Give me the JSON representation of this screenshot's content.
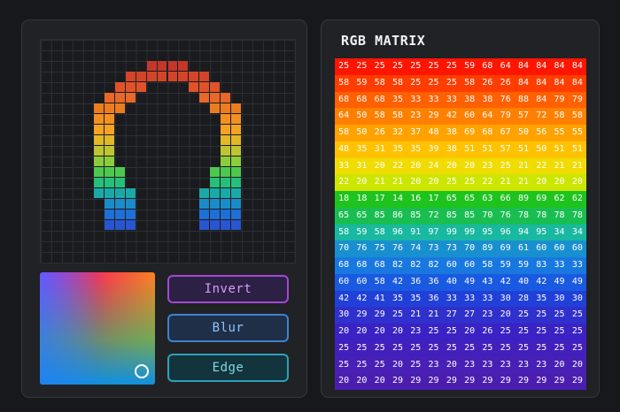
{
  "pixel_art": {
    "grid_cols": 24,
    "grid_rows": 21,
    "rows": [
      {
        "row": 2,
        "ranges": [
          [
            10,
            13
          ]
        ],
        "color": "#c5372a"
      },
      {
        "row": 3,
        "ranges": [
          [
            8,
            15
          ]
        ],
        "color": "#d44428"
      },
      {
        "row": 4,
        "ranges": [
          [
            7,
            9
          ],
          [
            14,
            16
          ]
        ],
        "color": "#e0532a"
      },
      {
        "row": 5,
        "ranges": [
          [
            6,
            8
          ],
          [
            15,
            17
          ]
        ],
        "color": "#e8682a"
      },
      {
        "row": 6,
        "ranges": [
          [
            5,
            7
          ],
          [
            16,
            18
          ]
        ],
        "color": "#ec7c20"
      },
      {
        "row": 7,
        "ranges": [
          [
            5,
            6
          ],
          [
            17,
            18
          ]
        ],
        "color": "#f39022"
      },
      {
        "row": 8,
        "ranges": [
          [
            5,
            6
          ],
          [
            17,
            18
          ]
        ],
        "color": "#f5a323"
      },
      {
        "row": 9,
        "ranges": [
          [
            5,
            6
          ],
          [
            17,
            18
          ]
        ],
        "color": "#e2b827"
      },
      {
        "row": 10,
        "ranges": [
          [
            5,
            6
          ],
          [
            17,
            18
          ]
        ],
        "color": "#bdc532"
      },
      {
        "row": 11,
        "ranges": [
          [
            5,
            6
          ],
          [
            17,
            18
          ]
        ],
        "color": "#8dcc3b"
      },
      {
        "row": 12,
        "ranges": [
          [
            5,
            7
          ],
          [
            16,
            18
          ]
        ],
        "color": "#4ec94f"
      },
      {
        "row": 13,
        "ranges": [
          [
            5,
            7
          ],
          [
            16,
            18
          ]
        ],
        "color": "#25bf7a"
      },
      {
        "row": 14,
        "ranges": [
          [
            5,
            8
          ],
          [
            15,
            18
          ]
        ],
        "color": "#1aa9a6"
      },
      {
        "row": 15,
        "ranges": [
          [
            6,
            8
          ],
          [
            15,
            18
          ]
        ],
        "color": "#1a8cc9"
      },
      {
        "row": 16,
        "ranges": [
          [
            6,
            8
          ],
          [
            15,
            18
          ]
        ],
        "color": "#1f6fd8"
      },
      {
        "row": 17,
        "ranges": [
          [
            6,
            8
          ],
          [
            15,
            18
          ]
        ],
        "color": "#2a55d0"
      }
    ]
  },
  "color_picker": {
    "handle_color": "#ffffff"
  },
  "buttons": {
    "invert_label": "Invert",
    "blur_label": "Blur",
    "edge_label": "Edge"
  },
  "matrix": {
    "title": "RGB MATRIX",
    "row_colors": [
      "#ff1500",
      "#ff3d00",
      "#ff6000",
      "#ff8000",
      "#ffa200",
      "#ffc200",
      "#f0dc00",
      "#cce600",
      "#1ec31e",
      "#1abe50",
      "#19b8a0",
      "#1890d0",
      "#1878e0",
      "#1a5ae0",
      "#2040d8",
      "#3030cc",
      "#3a22c4",
      "#4220bc",
      "#4820b6",
      "#4c1eb0"
    ],
    "rows": [
      [
        "25",
        "25",
        "25",
        "25",
        "25",
        "25",
        "25",
        "59",
        "68",
        "64",
        "84",
        "84",
        "84",
        "84"
      ],
      [
        "58",
        "59",
        "58",
        "58",
        "25",
        "25",
        "25",
        "58",
        "26",
        "26",
        "84",
        "84",
        "84",
        "84"
      ],
      [
        "68",
        "68",
        "68",
        "35",
        "33",
        "33",
        "33",
        "38",
        "38",
        "76",
        "88",
        "84",
        "79",
        "79"
      ],
      [
        "64",
        "50",
        "58",
        "58",
        "23",
        "29",
        "42",
        "60",
        "64",
        "79",
        "57",
        "72",
        "58",
        "58"
      ],
      [
        "58",
        "50",
        "26",
        "32",
        "37",
        "48",
        "38",
        "69",
        "68",
        "67",
        "50",
        "56",
        "55",
        "55"
      ],
      [
        "48",
        "35",
        "31",
        "35",
        "35",
        "39",
        "38",
        "51",
        "51",
        "57",
        "51",
        "50",
        "51",
        "51"
      ],
      [
        "33",
        "31",
        "20",
        "22",
        "20",
        "24",
        "20",
        "20",
        "23",
        "25",
        "21",
        "22",
        "21",
        "21"
      ],
      [
        "22",
        "20",
        "21",
        "21",
        "20",
        "20",
        "25",
        "25",
        "22",
        "21",
        "21",
        "20",
        "20",
        "20"
      ],
      [
        "18",
        "18",
        "17",
        "14",
        "16",
        "17",
        "65",
        "65",
        "63",
        "66",
        "89",
        "69",
        "62",
        "62"
      ],
      [
        "65",
        "65",
        "85",
        "86",
        "85",
        "72",
        "85",
        "85",
        "70",
        "76",
        "78",
        "78",
        "78",
        "78"
      ],
      [
        "58",
        "59",
        "58",
        "96",
        "91",
        "97",
        "99",
        "99",
        "95",
        "96",
        "94",
        "95",
        "34",
        "34"
      ],
      [
        "70",
        "76",
        "75",
        "76",
        "74",
        "73",
        "73",
        "70",
        "89",
        "69",
        "61",
        "60",
        "60",
        "60"
      ],
      [
        "68",
        "68",
        "68",
        "82",
        "82",
        "82",
        "60",
        "60",
        "58",
        "59",
        "59",
        "83",
        "33",
        "33"
      ],
      [
        "60",
        "60",
        "58",
        "42",
        "36",
        "36",
        "40",
        "49",
        "43",
        "42",
        "40",
        "42",
        "49",
        "49"
      ],
      [
        "42",
        "42",
        "41",
        "35",
        "35",
        "36",
        "33",
        "33",
        "33",
        "30",
        "28",
        "35",
        "30",
        "30"
      ],
      [
        "30",
        "29",
        "29",
        "25",
        "21",
        "21",
        "27",
        "27",
        "23",
        "20",
        "25",
        "25",
        "25",
        "25"
      ],
      [
        "20",
        "20",
        "20",
        "20",
        "23",
        "25",
        "25",
        "20",
        "26",
        "25",
        "25",
        "25",
        "25",
        "25"
      ],
      [
        "25",
        "25",
        "25",
        "25",
        "25",
        "25",
        "25",
        "25",
        "25",
        "25",
        "25",
        "25",
        "25",
        "25"
      ],
      [
        "25",
        "25",
        "25",
        "20",
        "25",
        "23",
        "20",
        "23",
        "23",
        "23",
        "23",
        "23",
        "20",
        "20"
      ],
      [
        "20",
        "20",
        "20",
        "29",
        "29",
        "29",
        "29",
        "29",
        "29",
        "29",
        "29",
        "29",
        "29",
        "29"
      ]
    ]
  }
}
